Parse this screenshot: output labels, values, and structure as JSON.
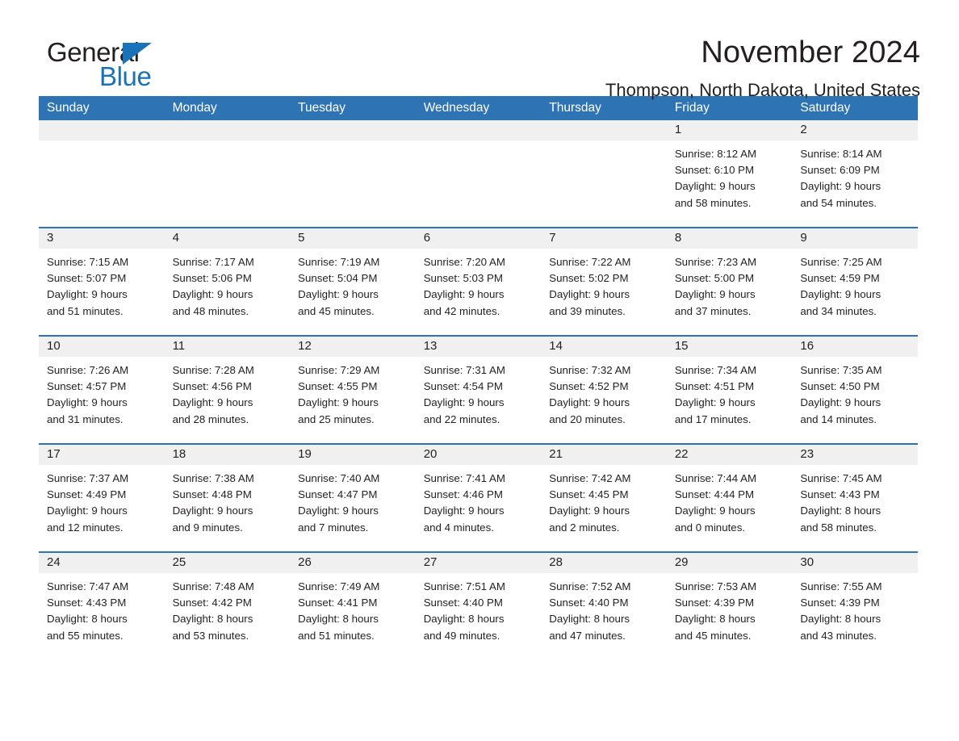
{
  "logo": {
    "word_one": "General",
    "word_two": "Blue",
    "triangle_icon": "blue-triangle-icon",
    "brand_color": "#1a72b8"
  },
  "header": {
    "title": "November 2024",
    "subtitle": "Thompson, North Dakota, United States"
  },
  "colors": {
    "header_bg": "#2e74b5",
    "header_text": "#ffffff",
    "daynum_band": "#f0f0f0",
    "text": "#231f20"
  },
  "calendar": {
    "weekday_headers": [
      "Sunday",
      "Monday",
      "Tuesday",
      "Wednesday",
      "Thursday",
      "Friday",
      "Saturday"
    ],
    "weeks": [
      [
        {
          "day": "",
          "sunrise": "",
          "sunset": "",
          "daylight1": "",
          "daylight2": ""
        },
        {
          "day": "",
          "sunrise": "",
          "sunset": "",
          "daylight1": "",
          "daylight2": ""
        },
        {
          "day": "",
          "sunrise": "",
          "sunset": "",
          "daylight1": "",
          "daylight2": ""
        },
        {
          "day": "",
          "sunrise": "",
          "sunset": "",
          "daylight1": "",
          "daylight2": ""
        },
        {
          "day": "",
          "sunrise": "",
          "sunset": "",
          "daylight1": "",
          "daylight2": ""
        },
        {
          "day": "1",
          "sunrise": "Sunrise: 8:12 AM",
          "sunset": "Sunset: 6:10 PM",
          "daylight1": "Daylight: 9 hours",
          "daylight2": "and 58 minutes."
        },
        {
          "day": "2",
          "sunrise": "Sunrise: 8:14 AM",
          "sunset": "Sunset: 6:09 PM",
          "daylight1": "Daylight: 9 hours",
          "daylight2": "and 54 minutes."
        }
      ],
      [
        {
          "day": "3",
          "sunrise": "Sunrise: 7:15 AM",
          "sunset": "Sunset: 5:07 PM",
          "daylight1": "Daylight: 9 hours",
          "daylight2": "and 51 minutes."
        },
        {
          "day": "4",
          "sunrise": "Sunrise: 7:17 AM",
          "sunset": "Sunset: 5:06 PM",
          "daylight1": "Daylight: 9 hours",
          "daylight2": "and 48 minutes."
        },
        {
          "day": "5",
          "sunrise": "Sunrise: 7:19 AM",
          "sunset": "Sunset: 5:04 PM",
          "daylight1": "Daylight: 9 hours",
          "daylight2": "and 45 minutes."
        },
        {
          "day": "6",
          "sunrise": "Sunrise: 7:20 AM",
          "sunset": "Sunset: 5:03 PM",
          "daylight1": "Daylight: 9 hours",
          "daylight2": "and 42 minutes."
        },
        {
          "day": "7",
          "sunrise": "Sunrise: 7:22 AM",
          "sunset": "Sunset: 5:02 PM",
          "daylight1": "Daylight: 9 hours",
          "daylight2": "and 39 minutes."
        },
        {
          "day": "8",
          "sunrise": "Sunrise: 7:23 AM",
          "sunset": "Sunset: 5:00 PM",
          "daylight1": "Daylight: 9 hours",
          "daylight2": "and 37 minutes."
        },
        {
          "day": "9",
          "sunrise": "Sunrise: 7:25 AM",
          "sunset": "Sunset: 4:59 PM",
          "daylight1": "Daylight: 9 hours",
          "daylight2": "and 34 minutes."
        }
      ],
      [
        {
          "day": "10",
          "sunrise": "Sunrise: 7:26 AM",
          "sunset": "Sunset: 4:57 PM",
          "daylight1": "Daylight: 9 hours",
          "daylight2": "and 31 minutes."
        },
        {
          "day": "11",
          "sunrise": "Sunrise: 7:28 AM",
          "sunset": "Sunset: 4:56 PM",
          "daylight1": "Daylight: 9 hours",
          "daylight2": "and 28 minutes."
        },
        {
          "day": "12",
          "sunrise": "Sunrise: 7:29 AM",
          "sunset": "Sunset: 4:55 PM",
          "daylight1": "Daylight: 9 hours",
          "daylight2": "and 25 minutes."
        },
        {
          "day": "13",
          "sunrise": "Sunrise: 7:31 AM",
          "sunset": "Sunset: 4:54 PM",
          "daylight1": "Daylight: 9 hours",
          "daylight2": "and 22 minutes."
        },
        {
          "day": "14",
          "sunrise": "Sunrise: 7:32 AM",
          "sunset": "Sunset: 4:52 PM",
          "daylight1": "Daylight: 9 hours",
          "daylight2": "and 20 minutes."
        },
        {
          "day": "15",
          "sunrise": "Sunrise: 7:34 AM",
          "sunset": "Sunset: 4:51 PM",
          "daylight1": "Daylight: 9 hours",
          "daylight2": "and 17 minutes."
        },
        {
          "day": "16",
          "sunrise": "Sunrise: 7:35 AM",
          "sunset": "Sunset: 4:50 PM",
          "daylight1": "Daylight: 9 hours",
          "daylight2": "and 14 minutes."
        }
      ],
      [
        {
          "day": "17",
          "sunrise": "Sunrise: 7:37 AM",
          "sunset": "Sunset: 4:49 PM",
          "daylight1": "Daylight: 9 hours",
          "daylight2": "and 12 minutes."
        },
        {
          "day": "18",
          "sunrise": "Sunrise: 7:38 AM",
          "sunset": "Sunset: 4:48 PM",
          "daylight1": "Daylight: 9 hours",
          "daylight2": "and 9 minutes."
        },
        {
          "day": "19",
          "sunrise": "Sunrise: 7:40 AM",
          "sunset": "Sunset: 4:47 PM",
          "daylight1": "Daylight: 9 hours",
          "daylight2": "and 7 minutes."
        },
        {
          "day": "20",
          "sunrise": "Sunrise: 7:41 AM",
          "sunset": "Sunset: 4:46 PM",
          "daylight1": "Daylight: 9 hours",
          "daylight2": "and 4 minutes."
        },
        {
          "day": "21",
          "sunrise": "Sunrise: 7:42 AM",
          "sunset": "Sunset: 4:45 PM",
          "daylight1": "Daylight: 9 hours",
          "daylight2": "and 2 minutes."
        },
        {
          "day": "22",
          "sunrise": "Sunrise: 7:44 AM",
          "sunset": "Sunset: 4:44 PM",
          "daylight1": "Daylight: 9 hours",
          "daylight2": "and 0 minutes."
        },
        {
          "day": "23",
          "sunrise": "Sunrise: 7:45 AM",
          "sunset": "Sunset: 4:43 PM",
          "daylight1": "Daylight: 8 hours",
          "daylight2": "and 58 minutes."
        }
      ],
      [
        {
          "day": "24",
          "sunrise": "Sunrise: 7:47 AM",
          "sunset": "Sunset: 4:43 PM",
          "daylight1": "Daylight: 8 hours",
          "daylight2": "and 55 minutes."
        },
        {
          "day": "25",
          "sunrise": "Sunrise: 7:48 AM",
          "sunset": "Sunset: 4:42 PM",
          "daylight1": "Daylight: 8 hours",
          "daylight2": "and 53 minutes."
        },
        {
          "day": "26",
          "sunrise": "Sunrise: 7:49 AM",
          "sunset": "Sunset: 4:41 PM",
          "daylight1": "Daylight: 8 hours",
          "daylight2": "and 51 minutes."
        },
        {
          "day": "27",
          "sunrise": "Sunrise: 7:51 AM",
          "sunset": "Sunset: 4:40 PM",
          "daylight1": "Daylight: 8 hours",
          "daylight2": "and 49 minutes."
        },
        {
          "day": "28",
          "sunrise": "Sunrise: 7:52 AM",
          "sunset": "Sunset: 4:40 PM",
          "daylight1": "Daylight: 8 hours",
          "daylight2": "and 47 minutes."
        },
        {
          "day": "29",
          "sunrise": "Sunrise: 7:53 AM",
          "sunset": "Sunset: 4:39 PM",
          "daylight1": "Daylight: 8 hours",
          "daylight2": "and 45 minutes."
        },
        {
          "day": "30",
          "sunrise": "Sunrise: 7:55 AM",
          "sunset": "Sunset: 4:39 PM",
          "daylight1": "Daylight: 8 hours",
          "daylight2": "and 43 minutes."
        }
      ]
    ]
  }
}
